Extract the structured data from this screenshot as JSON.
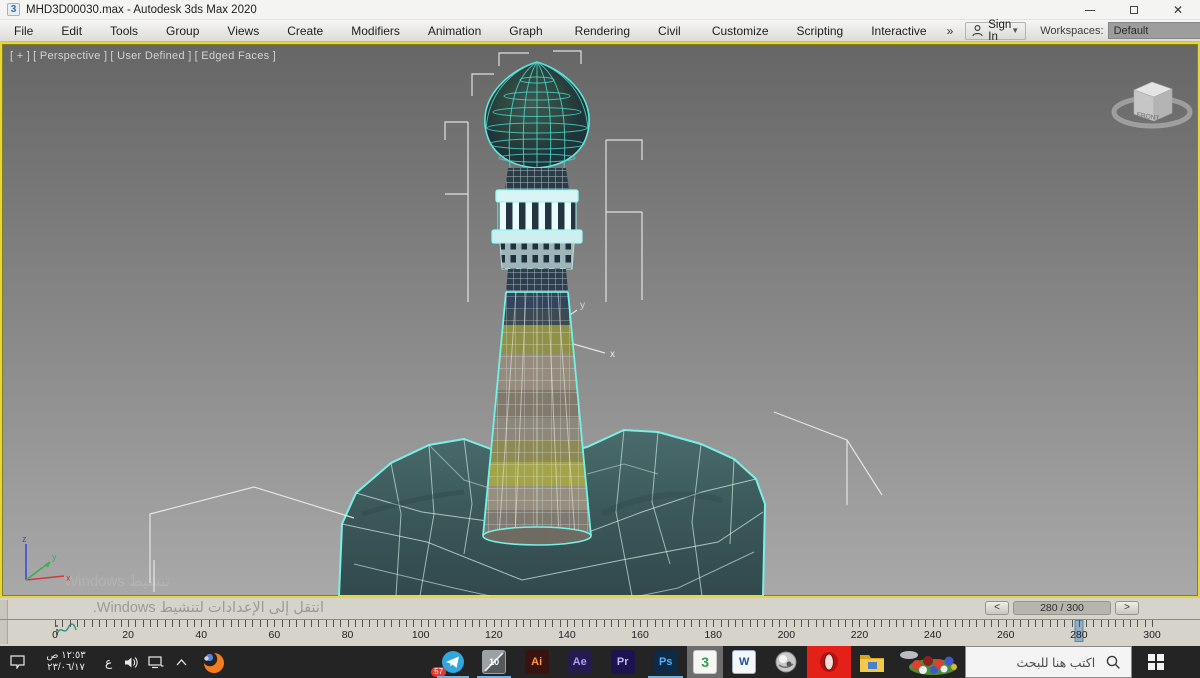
{
  "title_bar": {
    "title": "MHD3D00030.max - Autodesk 3ds Max 2020",
    "app_icon_label": "3"
  },
  "menu_bar": {
    "items": [
      "File",
      "Edit",
      "Tools",
      "Group",
      "Views",
      "Create",
      "Modifiers",
      "Animation",
      "Graph Editors",
      "Rendering",
      "Civil View",
      "Customize",
      "Scripting",
      "Interactive"
    ],
    "overflow_glyph": "»",
    "sign_in_label": "Sign In",
    "workspaces_label": "Workspaces:",
    "workspace_value": "Default"
  },
  "viewport": {
    "label_segments": [
      "[ + ]",
      "[ Perspective ]",
      "[ User Defined ]",
      "[ Edged Faces ]"
    ],
    "viewcube_face": "FRONT",
    "axis_labels": {
      "x": "x",
      "y": "y",
      "z": "z"
    },
    "watermark_line": "تنشيط Windows",
    "selection_color": "#6ff2e7",
    "background_top": "#666666",
    "background_bottom": "#a9a9a9",
    "active_border_color": "#e6d63e"
  },
  "status_bar": {
    "activation_watermark": "انتقل إلى الإعدادات لتنشيط Windows.",
    "prev_label": "<",
    "next_label": ">",
    "frame_indicator": "280 / 300"
  },
  "timeline": {
    "start": 0,
    "end": 300,
    "current": 280,
    "tick_step": 2,
    "labels": [
      0,
      20,
      40,
      60,
      80,
      100,
      120,
      140,
      160,
      180,
      200,
      220,
      240,
      260,
      280,
      300
    ]
  },
  "taskbar": {
    "search_placeholder": "اكتب هنا للبحث",
    "clock_time": "١٢:٥٣ ص",
    "clock_date": "٢٣/٠٦/١٧",
    "language_indicator": "ع",
    "telegram_badge": "57",
    "app10_label": "10",
    "adobe_ai": "Ai",
    "adobe_ae": "Ae",
    "adobe_pr": "Pr",
    "adobe_ps": "Ps",
    "max_label": "3",
    "word_label": "W",
    "accent_underline": "#6fb3e8",
    "opera_red": "#e32119"
  }
}
